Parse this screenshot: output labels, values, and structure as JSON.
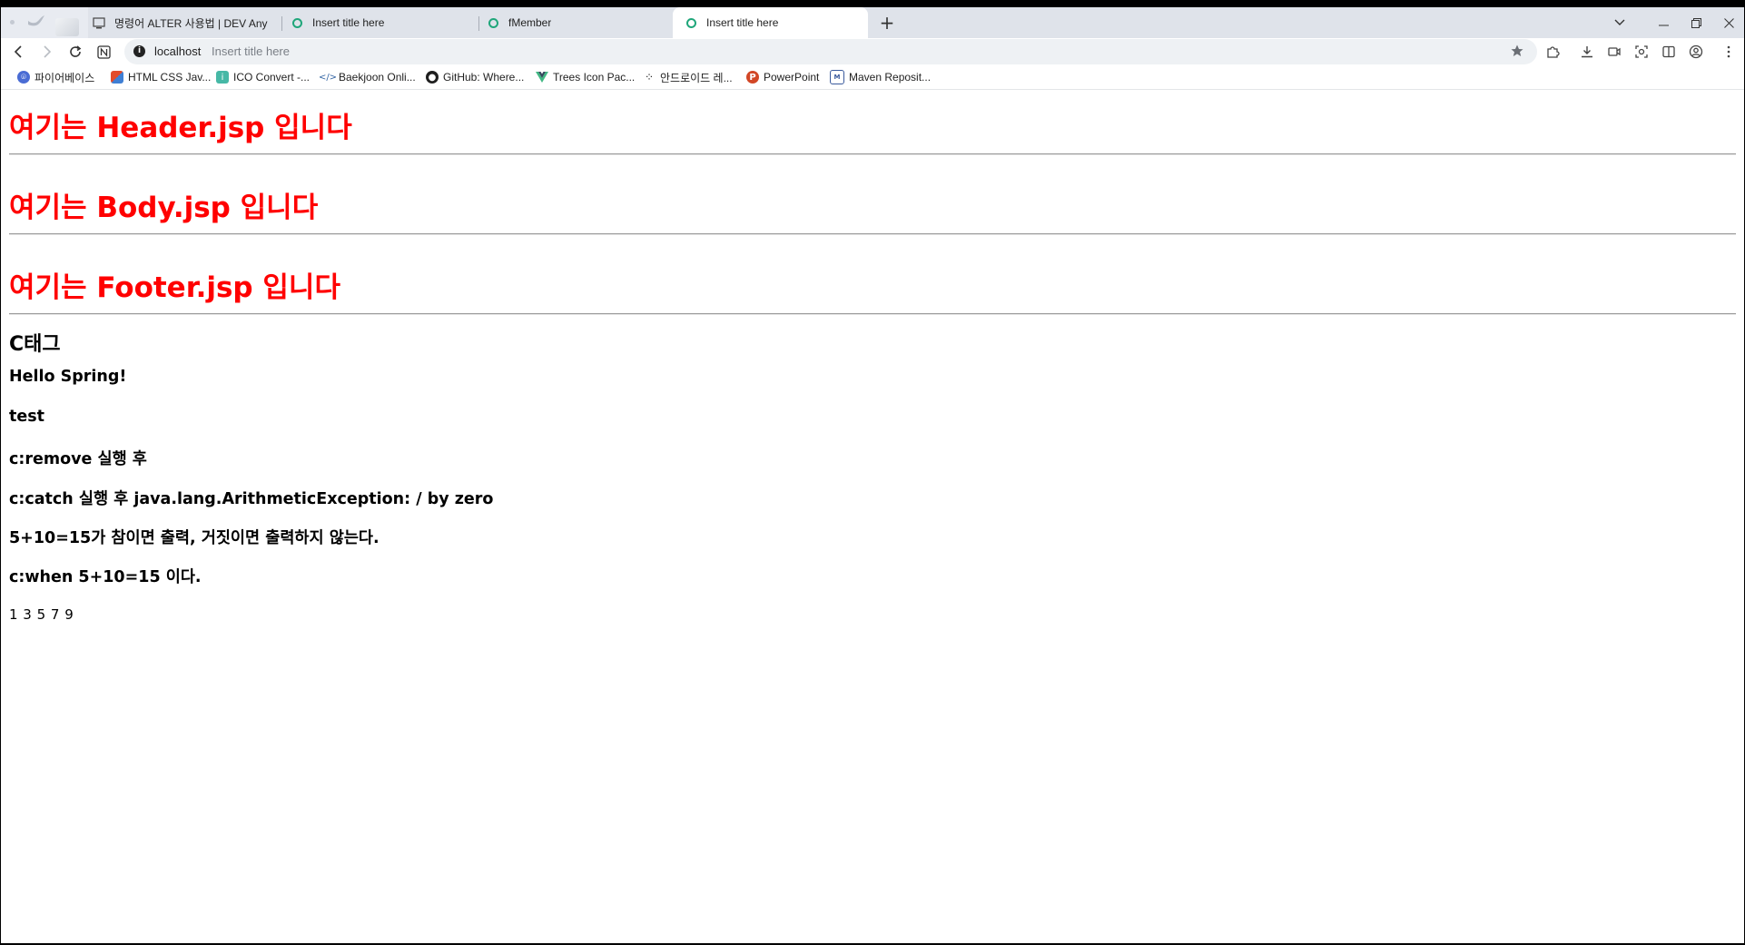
{
  "browser": {
    "tabs": [
      {
        "title": "명령어 ALTER 사용법 | DEV Any",
        "icon": "page-icon",
        "active": false
      },
      {
        "title": "Insert title here",
        "icon": "globe-ring-icon",
        "active": false
      },
      {
        "title": "fMember",
        "icon": "globe-ring-icon",
        "active": false
      },
      {
        "title": "Insert title here",
        "icon": "globe-ring-icon",
        "active": true
      }
    ],
    "new_tab_label": "+",
    "address": {
      "host": "localhost",
      "page_title": "Insert title here"
    },
    "bookmarks": [
      {
        "label": "파이어베이스",
        "icon": "firebase-icon",
        "color": "#4a6cd4"
      },
      {
        "label": "HTML CSS Jav...",
        "icon": "blocks-icon",
        "color": "#e24c2b"
      },
      {
        "label": "ICO Convert -...",
        "icon": "ico-icon",
        "color": "#46b8a6"
      },
      {
        "label": "Baekjoon Onli...",
        "icon": "code-icon",
        "color": "#3465a4"
      },
      {
        "label": "GitHub: Where...",
        "icon": "github-icon",
        "color": "#1f1f1f"
      },
      {
        "label": "Trees Icon Pac...",
        "icon": "vue-icon",
        "color": "#41b883"
      },
      {
        "label": "안드로이드 레...",
        "icon": "dots-icon",
        "color": "#222222"
      },
      {
        "label": "PowerPoint",
        "icon": "powerpoint-icon",
        "color": "#d24726"
      },
      {
        "label": "Maven Reposit...",
        "icon": "maven-icon",
        "color": "#3a5a9c"
      }
    ]
  },
  "content": {
    "header_text": "여기는 Header.jsp 입니다",
    "body_text": "여기는 Body.jsp 입니다",
    "footer_text": "여기는 Footer.jsp 입니다",
    "section_title": "C태그",
    "lines": [
      "Hello Spring!",
      "test",
      "c:remove 실행 후",
      "c:catch 실행 후 java.lang.ArithmeticException: / by zero",
      "5+10=15가 참이면 출력, 거짓이면 출력하지 않는다.",
      "c:when 5+10=15 이다."
    ],
    "numbers": "1 3 5 7 9",
    "heading_color": "#ff0000"
  }
}
